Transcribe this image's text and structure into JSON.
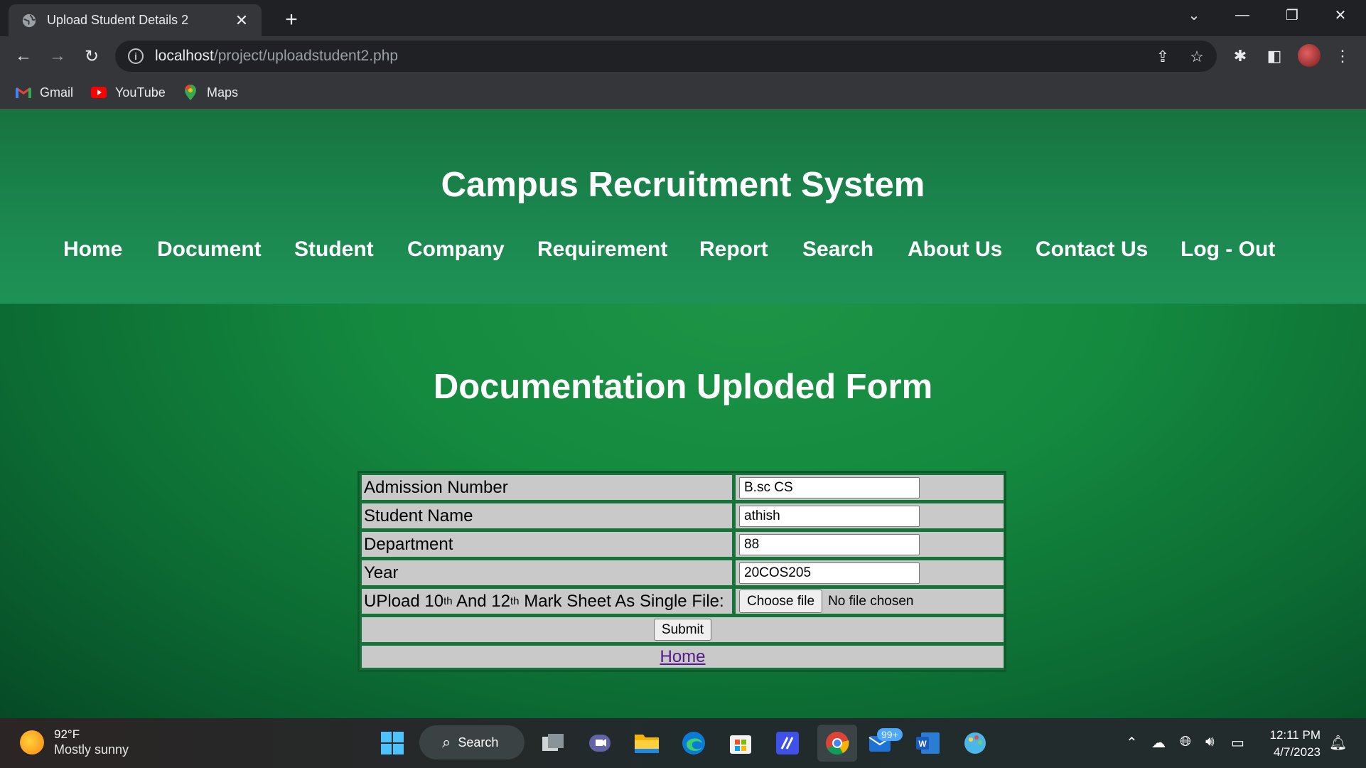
{
  "browser": {
    "tab_title": "Upload Student Details 2",
    "url_host": "localhost",
    "url_path": "/project/uploadstudent2.php",
    "bookmarks": [
      "Gmail",
      "YouTube",
      "Maps"
    ]
  },
  "site": {
    "title": "Campus Recruitment System",
    "nav": [
      "Home",
      "Document",
      "Student",
      "Company",
      "Requirement",
      "Report",
      "Search",
      "About Us",
      "Contact Us",
      "Log - Out"
    ]
  },
  "form": {
    "title": "Documentation Uploded Form",
    "rows": [
      {
        "label": "Admission Number",
        "value": "B.sc CS"
      },
      {
        "label": "Student Name",
        "value": "athish"
      },
      {
        "label": "Department",
        "value": "88"
      },
      {
        "label": "Year",
        "value": "20COS205"
      }
    ],
    "file_label_a": "UPload 10",
    "file_label_sup1": "th",
    "file_label_b": " And 12",
    "file_label_sup2": "th",
    "file_label_c": " Mark Sheet As Single File:",
    "file_button": "Choose file",
    "file_status": "No file chosen",
    "submit": "Submit",
    "home_link": "Home"
  },
  "taskbar": {
    "temperature": "92°F",
    "condition": "Mostly sunny",
    "search": "Search",
    "badge": "99+",
    "time": "12:11 PM",
    "date": "4/7/2023"
  }
}
